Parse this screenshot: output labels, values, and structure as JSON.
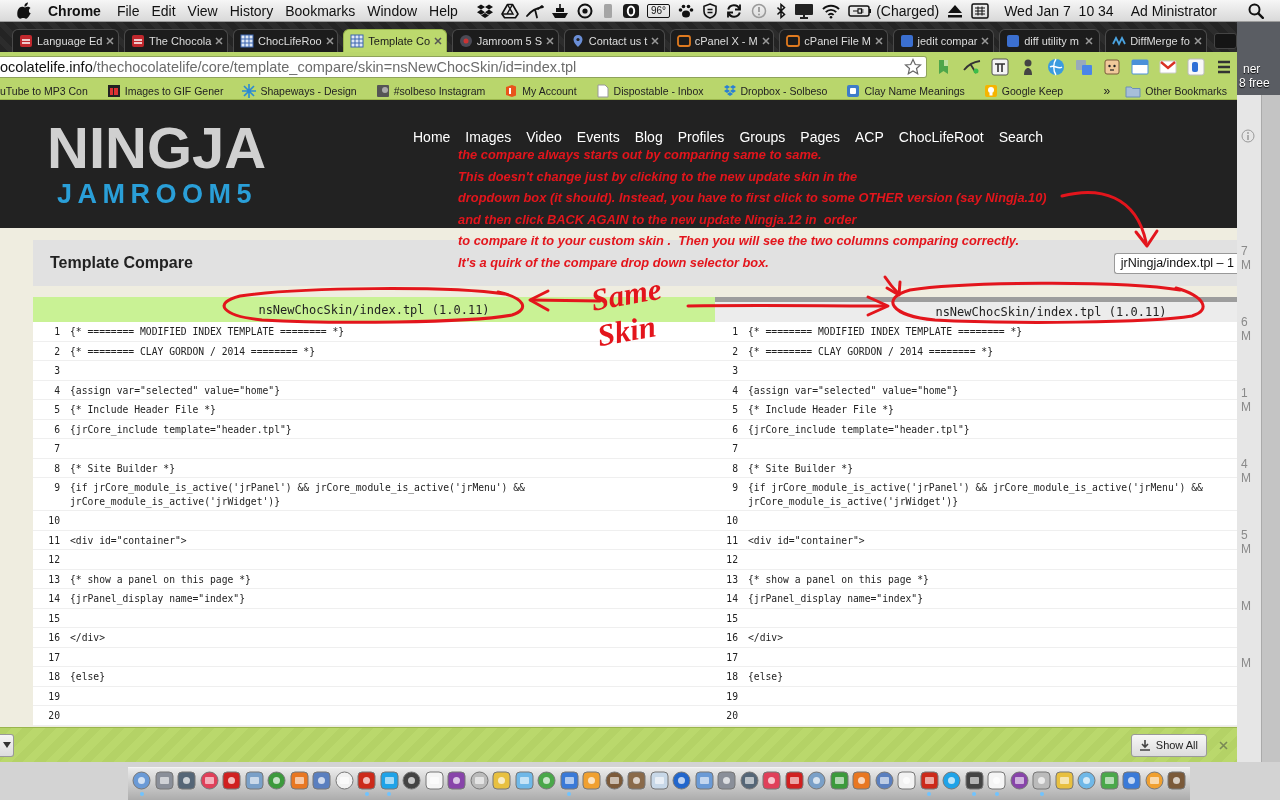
{
  "menu_bar": {
    "app_name": "Chrome",
    "menus": [
      "File",
      "Edit",
      "View",
      "History",
      "Bookmarks",
      "Window",
      "Help"
    ],
    "temperature": "96°",
    "battery_status": "(Charged)",
    "clock": "Wed Jan 7  10 34",
    "user": "Ad Ministrator"
  },
  "browser": {
    "tabs": [
      {
        "title": "Language Ed",
        "selected": false
      },
      {
        "title": "The Chocola",
        "selected": false
      },
      {
        "title": "ChocLifeRoo",
        "selected": false
      },
      {
        "title": "Template Co",
        "selected": true
      },
      {
        "title": "Jamroom 5 S",
        "selected": false
      },
      {
        "title": "Contact us t",
        "selected": false
      },
      {
        "title": "cPanel X - M",
        "selected": false
      },
      {
        "title": "cPanel File M",
        "selected": false
      },
      {
        "title": "jedit compar",
        "selected": false
      },
      {
        "title": "diff utility m",
        "selected": false
      },
      {
        "title": "DiffMerge fo",
        "selected": false
      }
    ],
    "address": {
      "host": "ocolatelife.info",
      "path": "/thechocolatelife/core/template_compare/skin=nsNewChocSkin/id=index.tpl"
    },
    "bookmarks": [
      "uTube to MP3 Con",
      "Images to GIF Gener",
      "Shapeways - Design",
      "#solbeso Instagram",
      "My Account",
      "Dispostable - Inbox",
      "Dropbox - Solbeso",
      "Clay Name Meanings",
      "Google Keep"
    ],
    "overflow_label": "»",
    "other_bookmarks": "Other Bookmarks"
  },
  "site": {
    "logo": {
      "title": "NINGJA",
      "subtitle": "JAMROOM5"
    },
    "nav": [
      "Home",
      "Images",
      "Video",
      "Events",
      "Blog",
      "Profiles",
      "Groups",
      "Pages",
      "ACP",
      "ChocLifeRoot",
      "Search"
    ]
  },
  "compare": {
    "title": "Template Compare",
    "selector_value": "jrNingja/index.tpl – 1",
    "columns": [
      {
        "header": "nsNewChocSkin/index.tpl (1.0.11)",
        "highlighted": true,
        "lines": [
          {
            "number": "1",
            "code": "{* ======== MODIFIED INDEX TEMPLATE ======== *}"
          },
          {
            "number": "2",
            "code": "{* ======== CLAY GORDON / 2014 ======== *}"
          },
          {
            "number": "3"
          },
          {
            "number": "4",
            "code": "{assign var=\"selected\" value=\"home\"}"
          },
          {
            "number": "5",
            "code": "{* Include Header File *}"
          },
          {
            "number": "6",
            "code": "{jrCore_include template=\"header.tpl\"}"
          },
          {
            "number": "7"
          },
          {
            "number": "8",
            "code": "{* Site Builder *}"
          },
          {
            "number": "9",
            "code": "{if jrCore_module_is_active('jrPanel') && jrCore_module_is_active('jrMenu') && jrCore_module_is_active('jrWidget')}"
          },
          {
            "number": "10"
          },
          {
            "number": "11",
            "code": "<div id=\"container\">"
          },
          {
            "number": "12"
          },
          {
            "number": "13",
            "code": "{* show a panel on this page *}"
          },
          {
            "number": "14",
            "code": "{jrPanel_display name=\"index\"}"
          },
          {
            "number": "15"
          },
          {
            "number": "16",
            "code": "</div>"
          },
          {
            "number": "17"
          },
          {
            "number": "18",
            "code": "{else}"
          },
          {
            "number": "19"
          },
          {
            "number": "20"
          }
        ]
      },
      {
        "header": "nsNewChocSkin/index.tpl (1.0.11)",
        "highlighted": false,
        "lines": [
          {
            "number": "1",
            "code": "{* ======== MODIFIED INDEX TEMPLATE ======== *}"
          },
          {
            "number": "2",
            "code": "{* ======== CLAY GORDON / 2014 ======== *}"
          },
          {
            "number": "3"
          },
          {
            "number": "4",
            "code": "{assign var=\"selected\" value=\"home\"}"
          },
          {
            "number": "5",
            "code": "{* Include Header File *}"
          },
          {
            "number": "6",
            "code": "{jrCore_include template=\"header.tpl\"}"
          },
          {
            "number": "7"
          },
          {
            "number": "8",
            "code": "{* Site Builder *}"
          },
          {
            "number": "9",
            "code": "{if jrCore_module_is_active('jrPanel') && jrCore_module_is_active('jrMenu') && jrCore_module_is_active('jrWidget')}"
          },
          {
            "number": "10"
          },
          {
            "number": "11",
            "code": "<div id=\"container\">"
          },
          {
            "number": "12"
          },
          {
            "number": "13",
            "code": "{* show a panel on this page *}"
          },
          {
            "number": "14",
            "code": "{jrPanel_display name=\"index\"}"
          },
          {
            "number": "15"
          },
          {
            "number": "16",
            "code": "</div>"
          },
          {
            "number": "17"
          },
          {
            "number": "18",
            "code": "{else}"
          },
          {
            "number": "19"
          },
          {
            "number": "20"
          }
        ]
      }
    ]
  },
  "annotation": {
    "note_lines": [
      "the compare always starts out by comparing same to same.",
      "This doesn't change just by clicking to the new update skin in the",
      "dropdown box (it should). Instead, you have to first click to some OTHER version (say Ningja.10)",
      "and then click BACK AGAIN to the new update Ningja.12 in  order",
      "to compare it to your custom skin .  Then you will see the two columns comparing correctly.",
      "It's a quirk of the compare drop down selector box."
    ],
    "mark": "Same Skin"
  },
  "downloads_bar": {
    "button": "Show All"
  },
  "background_window": {
    "desktop_labels": [
      "ner",
      "8 free"
    ],
    "times": [
      "7 M",
      "6 M",
      "1 M",
      "4 M",
      "5 M",
      "M",
      "M"
    ]
  },
  "dock": {
    "apps": [
      {
        "running": true
      },
      {
        "running": false
      },
      {
        "running": false
      },
      {
        "running": false
      },
      {
        "running": false
      },
      {
        "running": false
      },
      {
        "running": false
      },
      {
        "running": false
      },
      {
        "running": false
      },
      {
        "running": false
      },
      {
        "running": true
      },
      {
        "running": true
      },
      {
        "running": false
      },
      {
        "running": false
      },
      {
        "running": false
      },
      {
        "running": false
      },
      {
        "running": false
      },
      {
        "running": false
      },
      {
        "running": false
      },
      {
        "running": true
      },
      {
        "running": false
      },
      {
        "running": false
      },
      {
        "running": false
      },
      {
        "running": false
      },
      {
        "running": false
      },
      {
        "running": false
      },
      {
        "running": false
      },
      {
        "running": false
      },
      {
        "running": false
      },
      {
        "running": false
      },
      {
        "running": false
      },
      {
        "running": false
      },
      {
        "running": false
      },
      {
        "running": false
      },
      {
        "running": false
      },
      {
        "running": true
      },
      {
        "running": false
      },
      {
        "running": true
      },
      {
        "running": true
      },
      {
        "running": false
      },
      {
        "running": true
      },
      {
        "running": false
      },
      {
        "running": false
      },
      {
        "running": false
      },
      {
        "running": false
      },
      {
        "running": false
      },
      {
        "running": false
      }
    ]
  }
}
